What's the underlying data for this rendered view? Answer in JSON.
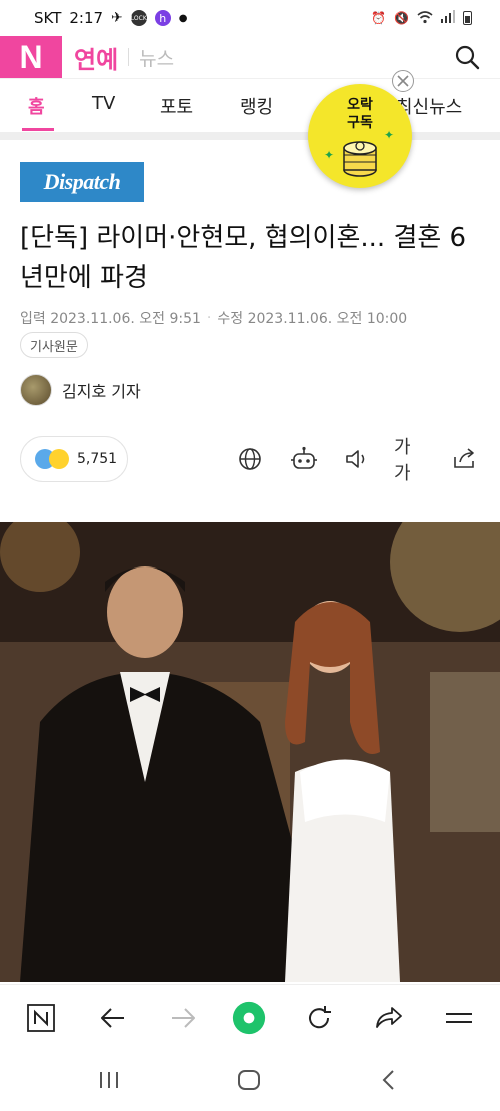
{
  "status_bar": {
    "carrier": "SKT",
    "time": "2:17",
    "app_badge_text": "LOCK",
    "app_badge2_text": "h"
  },
  "header": {
    "logo": "N",
    "section": "연예",
    "sub": "뉴스"
  },
  "tabs": [
    {
      "label": "홈",
      "active": true
    },
    {
      "label": "TV"
    },
    {
      "label": "포토"
    },
    {
      "label": "랭킹"
    },
    {
      "label": "최신뉴스"
    }
  ],
  "promo": {
    "line1": "오락",
    "line2": "구독"
  },
  "article": {
    "press": "Dispatch",
    "title": "[단독] 라이머·안현모, 협의이혼... 결혼 6년만에 파경",
    "input_date": "입력 2023.11.06. 오전 9:51",
    "modify_date": "수정 2023.11.06. 오전 10:00",
    "original_button": "기사원문",
    "author": "김지호 기자",
    "reaction_count": "5,751",
    "font_size_label": "가가"
  },
  "colors": {
    "brand_pink": "#f0469f",
    "promo_yellow": "#f4e62a",
    "press_blue": "#2e88c8",
    "reload_green": "#1ec36b"
  }
}
